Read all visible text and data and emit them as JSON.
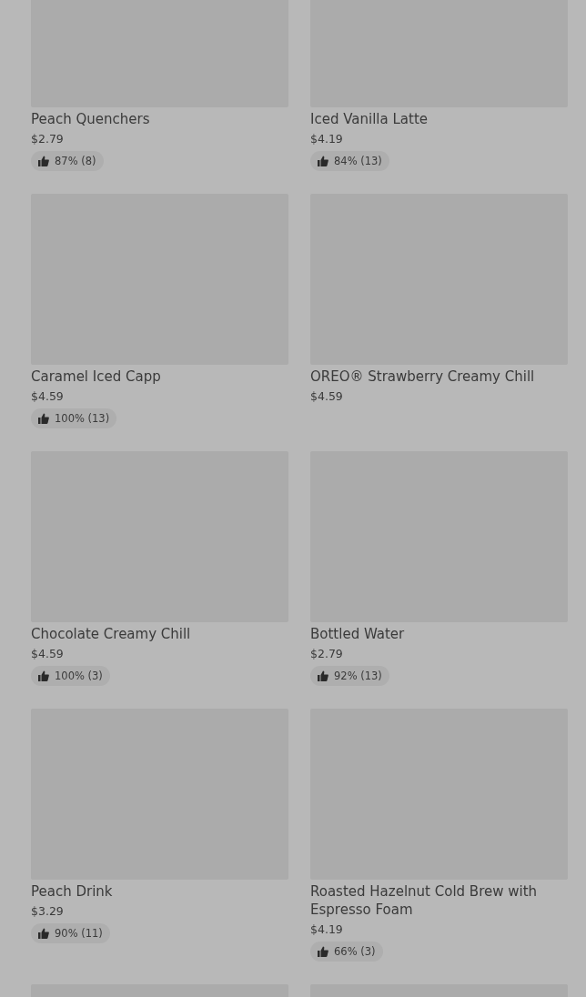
{
  "menu_items": [
    {
      "kind": "product",
      "name": "Peach Quenchers",
      "price": "$2.79",
      "rating": "87% (8)"
    },
    {
      "kind": "product",
      "name": "Iced Vanilla Latte",
      "price": "$4.19",
      "rating": "84% (13)"
    },
    {
      "kind": "product",
      "name": "Caramel Iced Capp",
      "price": "$4.59",
      "rating": "100% (13)"
    },
    {
      "kind": "product",
      "name": "OREO® Strawberry Creamy Chill",
      "price": "$4.59"
    },
    {
      "kind": "product",
      "name": "Chocolate Creamy Chill",
      "price": "$4.59",
      "rating": "100% (3)"
    },
    {
      "kind": "product",
      "name": "Bottled Water",
      "price": "$2.79",
      "rating": "92% (13)"
    },
    {
      "kind": "product",
      "name": "Peach Drink",
      "price": "$3.29",
      "rating": "90% (11)"
    },
    {
      "kind": "product",
      "name": "Roasted Hazelnut Cold Brew with Espresso Foam",
      "price": "$4.19",
      "rating": "66% (3)"
    },
    {
      "kind": "image_only"
    },
    {
      "kind": "image_only"
    }
  ]
}
